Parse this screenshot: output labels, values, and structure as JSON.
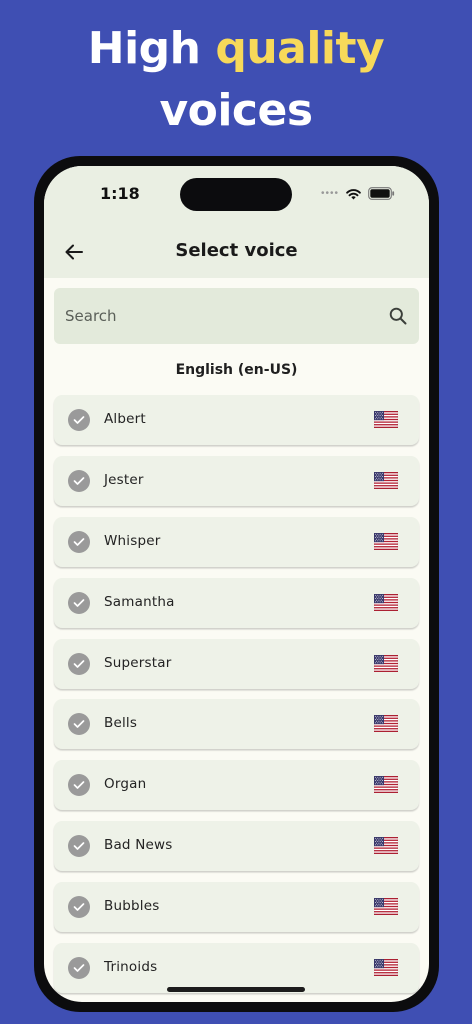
{
  "promo": {
    "word_1": "High",
    "word_2": "quality",
    "word_3": "voices",
    "accent_color": "#f7d95a",
    "background_color": "#3f4fb3"
  },
  "status_bar": {
    "time": "1:18",
    "icons": [
      "signal-dots-icon",
      "wifi-icon",
      "battery-icon"
    ]
  },
  "app_bar": {
    "title": "Select voice",
    "back_icon": "arrow-left-icon"
  },
  "search": {
    "placeholder": "Search",
    "icon": "search-icon"
  },
  "language_header": "English (en-US)",
  "voices": [
    {
      "name": "Albert",
      "flag": "us-flag-icon"
    },
    {
      "name": "Jester",
      "flag": "us-flag-icon"
    },
    {
      "name": "Whisper",
      "flag": "us-flag-icon"
    },
    {
      "name": "Samantha",
      "flag": "us-flag-icon"
    },
    {
      "name": "Superstar",
      "flag": "us-flag-icon"
    },
    {
      "name": "Bells",
      "flag": "us-flag-icon"
    },
    {
      "name": "Organ",
      "flag": "us-flag-icon"
    },
    {
      "name": "Bad News",
      "flag": "us-flag-icon"
    },
    {
      "name": "Bubbles",
      "flag": "us-flag-icon"
    },
    {
      "name": "Trinoids",
      "flag": "us-flag-icon"
    }
  ]
}
